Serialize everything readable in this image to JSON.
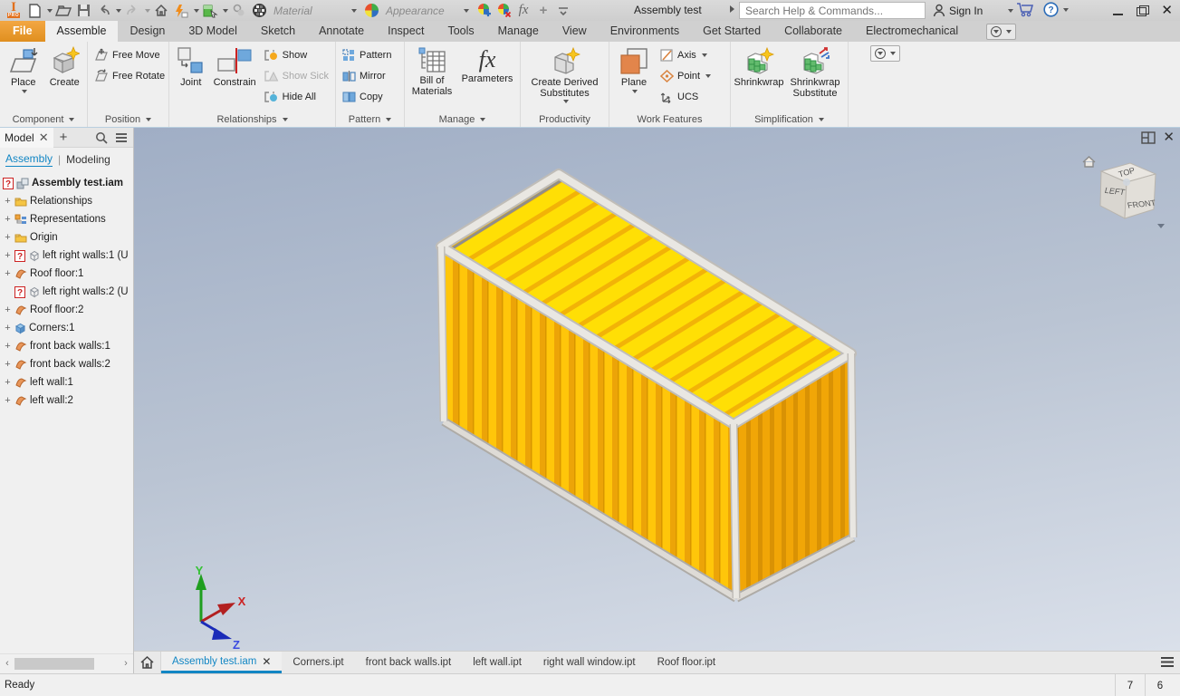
{
  "titlebar": {
    "title": "Assembly test",
    "search_placeholder": "Search Help & Commands...",
    "sign_in_label": "Sign In",
    "material_label": "Material",
    "appearance_label": "Appearance"
  },
  "ribbon": {
    "active_tab": "Assemble",
    "tabs": [
      "File",
      "Assemble",
      "Design",
      "3D Model",
      "Sketch",
      "Annotate",
      "Inspect",
      "Tools",
      "Manage",
      "View",
      "Environments",
      "Get Started",
      "Collaborate",
      "Electromechanical"
    ],
    "panels": [
      {
        "title": "Component",
        "buttons": [
          {
            "label": "Place"
          },
          {
            "label": "Create"
          }
        ]
      },
      {
        "title": "Position",
        "buttons": [
          {
            "label": "Free Move"
          },
          {
            "label": "Free Rotate"
          }
        ]
      },
      {
        "title": "Relationships",
        "buttons": [
          {
            "label": "Joint"
          },
          {
            "label": "Constrain"
          },
          {
            "label": "Show"
          },
          {
            "label": "Show Sick"
          },
          {
            "label": "Hide All"
          }
        ]
      },
      {
        "title": "Pattern",
        "buttons": [
          {
            "label": "Pattern"
          },
          {
            "label": "Mirror"
          },
          {
            "label": "Copy"
          }
        ]
      },
      {
        "title": "Manage",
        "buttons": [
          {
            "label": "Bill of Materials"
          },
          {
            "label": "Parameters"
          }
        ]
      },
      {
        "title": "Productivity",
        "buttons": [
          {
            "label": "Create Derived Substitutes"
          }
        ]
      },
      {
        "title": "Work Features",
        "buttons": [
          {
            "label": "Plane"
          },
          {
            "label": "Axis"
          },
          {
            "label": "Point"
          },
          {
            "label": "UCS"
          }
        ]
      },
      {
        "title": "Simplification",
        "buttons": [
          {
            "label": "Shrinkwrap"
          },
          {
            "label": "Shrinkwrap Substitute"
          }
        ]
      }
    ]
  },
  "browser": {
    "panel_tab": "Model",
    "view_tabs": [
      "Assembly",
      "Modeling"
    ],
    "tree": [
      {
        "label": "Assembly test.iam"
      },
      {
        "label": "Relationships"
      },
      {
        "label": "Representations"
      },
      {
        "label": "Origin"
      },
      {
        "label": "left right walls:1 (U"
      },
      {
        "label": "Roof floor:1"
      },
      {
        "label": "left right walls:2 (U"
      },
      {
        "label": "Roof floor:2"
      },
      {
        "label": "Corners:1"
      },
      {
        "label": "front back walls:1"
      },
      {
        "label": "front back walls:2"
      },
      {
        "label": "left wall:1"
      },
      {
        "label": "left wall:2"
      }
    ]
  },
  "viewport": {
    "viewcube_faces": [
      "TOP",
      "LEFT",
      "FRONT"
    ],
    "triad_labels": [
      "Y",
      "X",
      "Z"
    ],
    "colors": {
      "background_top": "#a0aec5",
      "background_bottom": "#dae0ea",
      "container_roof": "#ffdf05",
      "container_roof_rib": "#f2b307",
      "container_side": "#ffc60a",
      "container_side_rib": "#eca408",
      "container_end": "#f1a607",
      "container_end_rib": "#d99204",
      "container_frame": "#e9e7e2"
    }
  },
  "doc_tabs": [
    {
      "label": "Assembly test.iam"
    },
    {
      "label": "Corners.ipt"
    },
    {
      "label": "front back walls.ipt"
    },
    {
      "label": "left wall.ipt"
    },
    {
      "label": "right wall window.ipt"
    },
    {
      "label": "Roof floor.ipt"
    }
  ],
  "statusbar": {
    "message": "Ready",
    "counts": [
      "7",
      "6"
    ]
  }
}
